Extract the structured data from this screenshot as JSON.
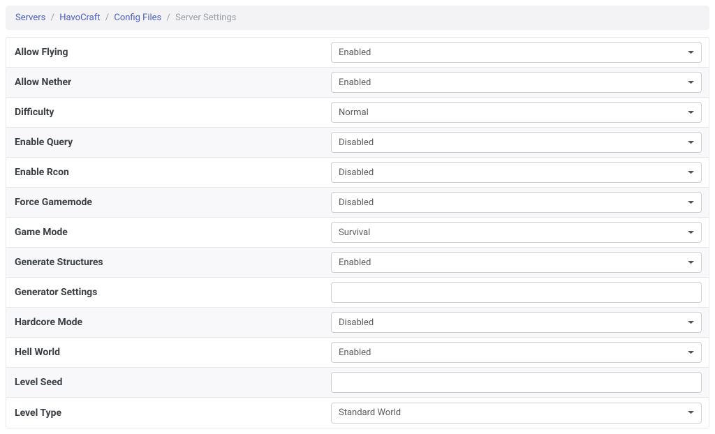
{
  "breadcrumb": {
    "items": [
      {
        "label": "Servers",
        "link": true
      },
      {
        "label": "HavoCraft",
        "link": true
      },
      {
        "label": "Config Files",
        "link": true
      },
      {
        "label": "Server Settings",
        "link": false
      }
    ]
  },
  "settings": [
    {
      "label": "Allow Flying",
      "type": "select",
      "value": "Enabled",
      "name": "allow-flying"
    },
    {
      "label": "Allow Nether",
      "type": "select",
      "value": "Enabled",
      "name": "allow-nether"
    },
    {
      "label": "Difficulty",
      "type": "select",
      "value": "Normal",
      "name": "difficulty"
    },
    {
      "label": "Enable Query",
      "type": "select",
      "value": "Disabled",
      "name": "enable-query"
    },
    {
      "label": "Enable Rcon",
      "type": "select",
      "value": "Disabled",
      "name": "enable-rcon"
    },
    {
      "label": "Force Gamemode",
      "type": "select",
      "value": "Disabled",
      "name": "force-gamemode"
    },
    {
      "label": "Game Mode",
      "type": "select",
      "value": "Survival",
      "name": "game-mode"
    },
    {
      "label": "Generate Structures",
      "type": "select",
      "value": "Enabled",
      "name": "generate-structures"
    },
    {
      "label": "Generator Settings",
      "type": "input",
      "value": "",
      "name": "generator-settings"
    },
    {
      "label": "Hardcore Mode",
      "type": "select",
      "value": "Disabled",
      "name": "hardcore-mode"
    },
    {
      "label": "Hell World",
      "type": "select",
      "value": "Enabled",
      "name": "hell-world"
    },
    {
      "label": "Level Seed",
      "type": "input",
      "value": "",
      "name": "level-seed"
    },
    {
      "label": "Level Type",
      "type": "select",
      "value": "Standard World",
      "name": "level-type"
    }
  ]
}
